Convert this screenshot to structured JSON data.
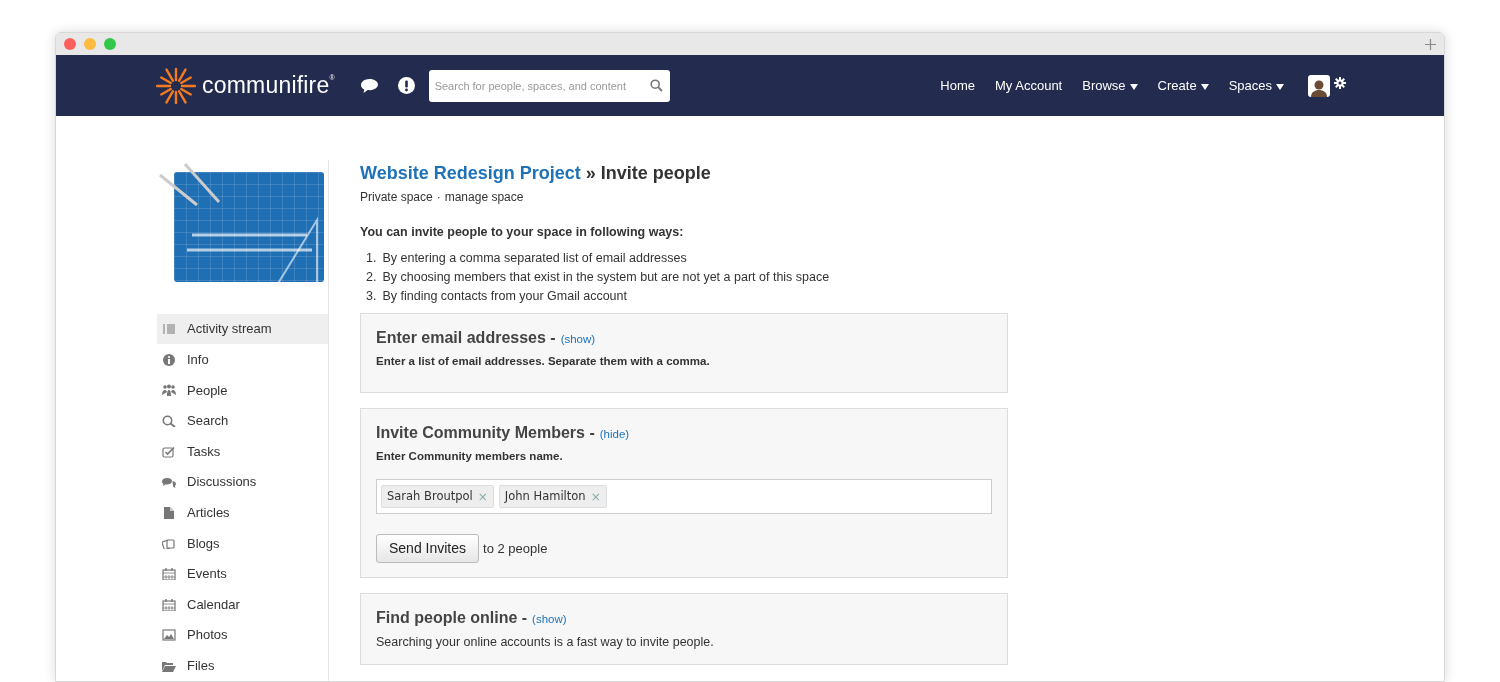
{
  "header": {
    "logo": "communifire",
    "logo_mark": "®",
    "search": {
      "placeholder": "Search for people, spaces, and content"
    },
    "nav": [
      {
        "label": "Home",
        "has_menu": false
      },
      {
        "label": "My Account",
        "has_menu": false
      },
      {
        "label": "Browse",
        "has_menu": true
      },
      {
        "label": "Create",
        "has_menu": true
      },
      {
        "label": "Spaces",
        "has_menu": true
      }
    ]
  },
  "sidebar": {
    "items": [
      {
        "label": "Activity stream",
        "selected": true
      },
      {
        "label": "Info",
        "selected": false
      },
      {
        "label": "People",
        "selected": false
      },
      {
        "label": "Search",
        "selected": false
      },
      {
        "label": "Tasks",
        "selected": false
      },
      {
        "label": "Discussions",
        "selected": false
      },
      {
        "label": "Articles",
        "selected": false
      },
      {
        "label": "Blogs",
        "selected": false
      },
      {
        "label": "Events",
        "selected": false
      },
      {
        "label": "Calendar",
        "selected": false
      },
      {
        "label": "Photos",
        "selected": false
      },
      {
        "label": "Files",
        "selected": false
      }
    ]
  },
  "page": {
    "space_link": "Website Redesign Project",
    "title": "» Invite people",
    "space_type": "Private space",
    "manage_link": "manage space",
    "separator": "·",
    "intro": "You can invite people to your space in following ways:",
    "ways": [
      {
        "number": "1.",
        "text": "By entering a comma separated list of email addresses"
      },
      {
        "number": "2.",
        "text": "By choosing members that exist in the system but are not yet a part of this space"
      },
      {
        "number": "3.",
        "text": "By finding contacts from your Gmail account"
      }
    ]
  },
  "sections": [
    {
      "kind": "form",
      "title": "Enter email addresses -",
      "toggle": "(show)",
      "description": "Enter a list of email addresses. Separate them with a comma.",
      "expanded": false
    },
    {
      "kind": "form",
      "title": "Invite Community Members -",
      "toggle": "(hide)",
      "description": "Enter Community members name.",
      "expanded": true,
      "tags": [
        {
          "label": "Sarah Broutpol",
          "remove": "×"
        },
        {
          "label": "John Hamilton",
          "remove": "×"
        }
      ],
      "button": "Send Invites",
      "count_text": "to 2 people"
    },
    {
      "kind": "info",
      "title": "Find people online -",
      "toggle": "(show)",
      "description": "Searching your online accounts is a fast way to invite people.",
      "expanded": false
    }
  ]
}
